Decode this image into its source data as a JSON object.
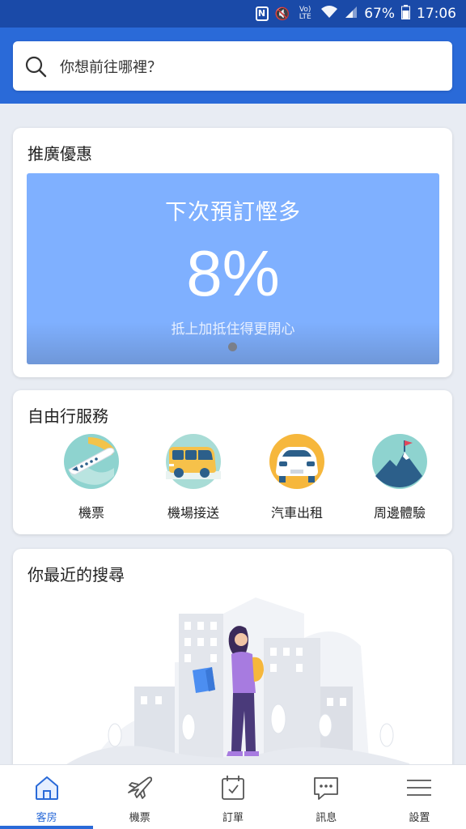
{
  "status_bar": {
    "battery": "67%",
    "time": "17:06",
    "volte": "Vo) LTE"
  },
  "search": {
    "placeholder": "你想前往哪裡？"
  },
  "promo": {
    "title": "推廣優惠",
    "headline": "下次預訂慳多",
    "value": "8%",
    "subtitle": "抵上加抵住得更開心"
  },
  "services": {
    "title": "自由行服務",
    "items": [
      {
        "label": "機票",
        "icon": "airplane-icon"
      },
      {
        "label": "機場接送",
        "icon": "shuttle-van-icon"
      },
      {
        "label": "汽車出租",
        "icon": "rental-car-icon"
      },
      {
        "label": "周邊體驗",
        "icon": "mountain-flag-icon"
      }
    ]
  },
  "recent": {
    "title": "你最近的搜尋"
  },
  "tabs": [
    {
      "label": "客房",
      "icon": "home-icon",
      "active": true
    },
    {
      "label": "機票",
      "icon": "airplane-icon",
      "active": false
    },
    {
      "label": "訂單",
      "icon": "calendar-check-icon",
      "active": false
    },
    {
      "label": "訊息",
      "icon": "chat-bubble-icon",
      "active": false
    },
    {
      "label": "設置",
      "icon": "menu-icon",
      "active": false
    }
  ],
  "colors": {
    "brand": "#2a6ad8",
    "status_bar": "#1a4aa8",
    "promo_banner": "#7fb0ff"
  }
}
